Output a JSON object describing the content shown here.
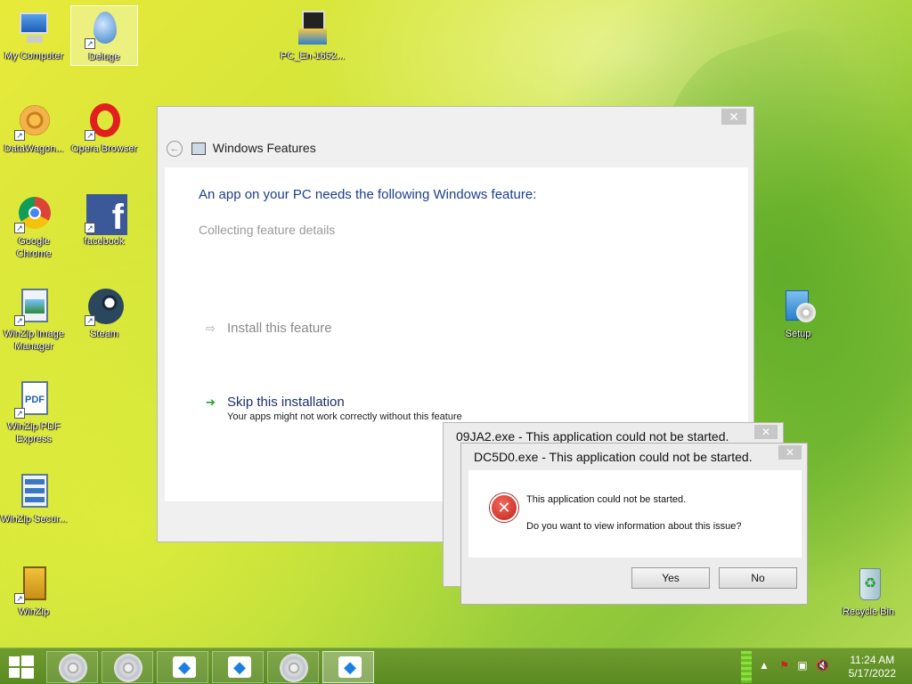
{
  "desktop": {
    "icons": [
      {
        "id": "my-computer",
        "label": "My Computer"
      },
      {
        "id": "deluge",
        "label": "Deluge"
      },
      {
        "id": "pc-en",
        "label": "PC_En-1652..."
      },
      {
        "id": "datawagon",
        "label": "DataWagon..."
      },
      {
        "id": "opera",
        "label": "Opera Browser"
      },
      {
        "id": "chrome",
        "label": "Google Chrome"
      },
      {
        "id": "facebook",
        "label": "facebook"
      },
      {
        "id": "winzip-image",
        "label": "WinZip Image Manager"
      },
      {
        "id": "steam",
        "label": "Steam"
      },
      {
        "id": "winzip-pdf",
        "label": "WinZip PDF Express"
      },
      {
        "id": "winzip-secure",
        "label": "WinZip Secur..."
      },
      {
        "id": "winzip",
        "label": "WinZip"
      },
      {
        "id": "setup",
        "label": "Setup"
      },
      {
        "id": "recycle-bin",
        "label": "Recycle Bin"
      }
    ]
  },
  "windows_features": {
    "title": "Windows Features",
    "close": "✕",
    "heading": "An app on your PC needs the following Windows feature:",
    "status": "Collecting feature details",
    "install_label": "Install this feature",
    "skip_label": "Skip this installation",
    "skip_sub": "Your apps might not work correctly without this feature"
  },
  "error_back": {
    "title": "09JA2.exe - This application could not be started.",
    "close": "✕"
  },
  "error_front": {
    "title": "DC5D0.exe - This application could not be started.",
    "close": "✕",
    "message1": "This application could not be started.",
    "message2": "Do you want to view information about this issue?",
    "yes_label": "Yes",
    "no_label": "No"
  },
  "taskbar": {
    "time": "11:24 AM",
    "date": "5/17/2022"
  }
}
